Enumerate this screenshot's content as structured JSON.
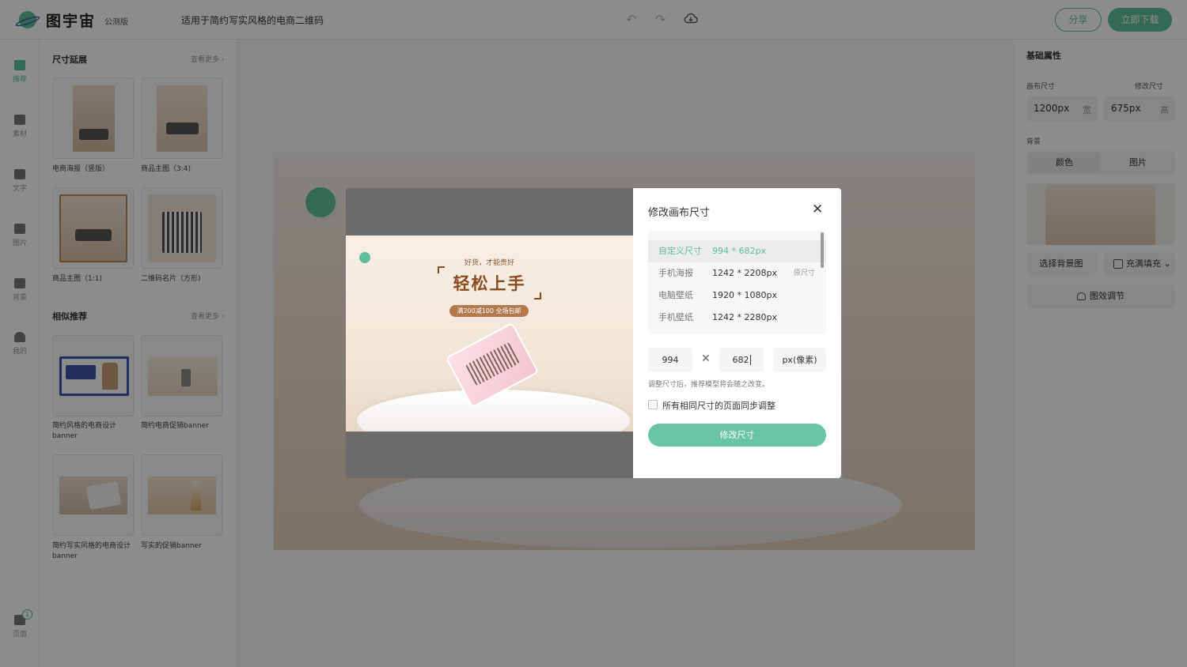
{
  "topbar": {
    "logo_text": "图宇宙",
    "beta": "公测版",
    "doc_title": "适用于简约写实风格的电商二维码",
    "share_label": "分享",
    "download_label": "立即下载"
  },
  "nav": {
    "items": [
      {
        "label": "推荐"
      },
      {
        "label": "素材"
      },
      {
        "label": "文字"
      },
      {
        "label": "图片"
      },
      {
        "label": "背景"
      },
      {
        "label": "我的"
      },
      {
        "label": "页面",
        "badge": "1"
      }
    ]
  },
  "panel": {
    "size_section": {
      "title": "尺寸延展",
      "more": "查看更多 ›"
    },
    "size_cards": [
      {
        "caption": "电商海报（竖版）"
      },
      {
        "caption": "商品主图（3:4)"
      },
      {
        "caption": "商品主图（1:1)"
      },
      {
        "caption": "二维码名片（方形)"
      }
    ],
    "similar_section": {
      "title": "相似推荐",
      "more": "查看更多 ›"
    },
    "similar_cards": [
      {
        "caption": "简约风格的电商设计banner"
      },
      {
        "caption": "简约电商促销banner"
      },
      {
        "caption": "简约写实风格的电商设计banner"
      },
      {
        "caption": "写实的促销banner"
      }
    ]
  },
  "right_panel": {
    "title": "基础属性",
    "canvas_size_label": "画布尺寸",
    "change_size_label": "修改尺寸",
    "width_value": "1200px",
    "width_unit": "宽",
    "height_value": "675px",
    "height_unit": "高",
    "background_label": "背景",
    "bg_tabs": [
      "颜色",
      "图片"
    ],
    "choose_bg_label": "选择背景图",
    "fill_label": "充满填充 ⌄",
    "effect_label": "图效调节"
  },
  "poster": {
    "subtitle": "好货，才能贵好",
    "headline": "轻松上手",
    "promo": "满200减100 全场包邮"
  },
  "modal": {
    "title": "修改画布尺寸",
    "presets": [
      {
        "name": "自定义尺寸",
        "value": "994 * 682px",
        "tag": ""
      },
      {
        "name": "手机海报",
        "value": "1242 * 2208px",
        "tag": "原尺寸"
      },
      {
        "name": "电脑壁纸",
        "value": "1920 * 1080px",
        "tag": ""
      },
      {
        "name": "手机壁纸",
        "value": "1242 * 2280px",
        "tag": ""
      }
    ],
    "width_input": "994",
    "height_input": "682",
    "unit_label": "px(像素)",
    "hint": "调整尺寸后，推荐模型将会随之改变。",
    "sync_label": "所有相同尺寸的页面同步调整",
    "submit_label": "修改尺寸"
  },
  "colors": {
    "accent": "#5fbf9a",
    "overlay": "rgba(0,0,0,0.45)"
  }
}
